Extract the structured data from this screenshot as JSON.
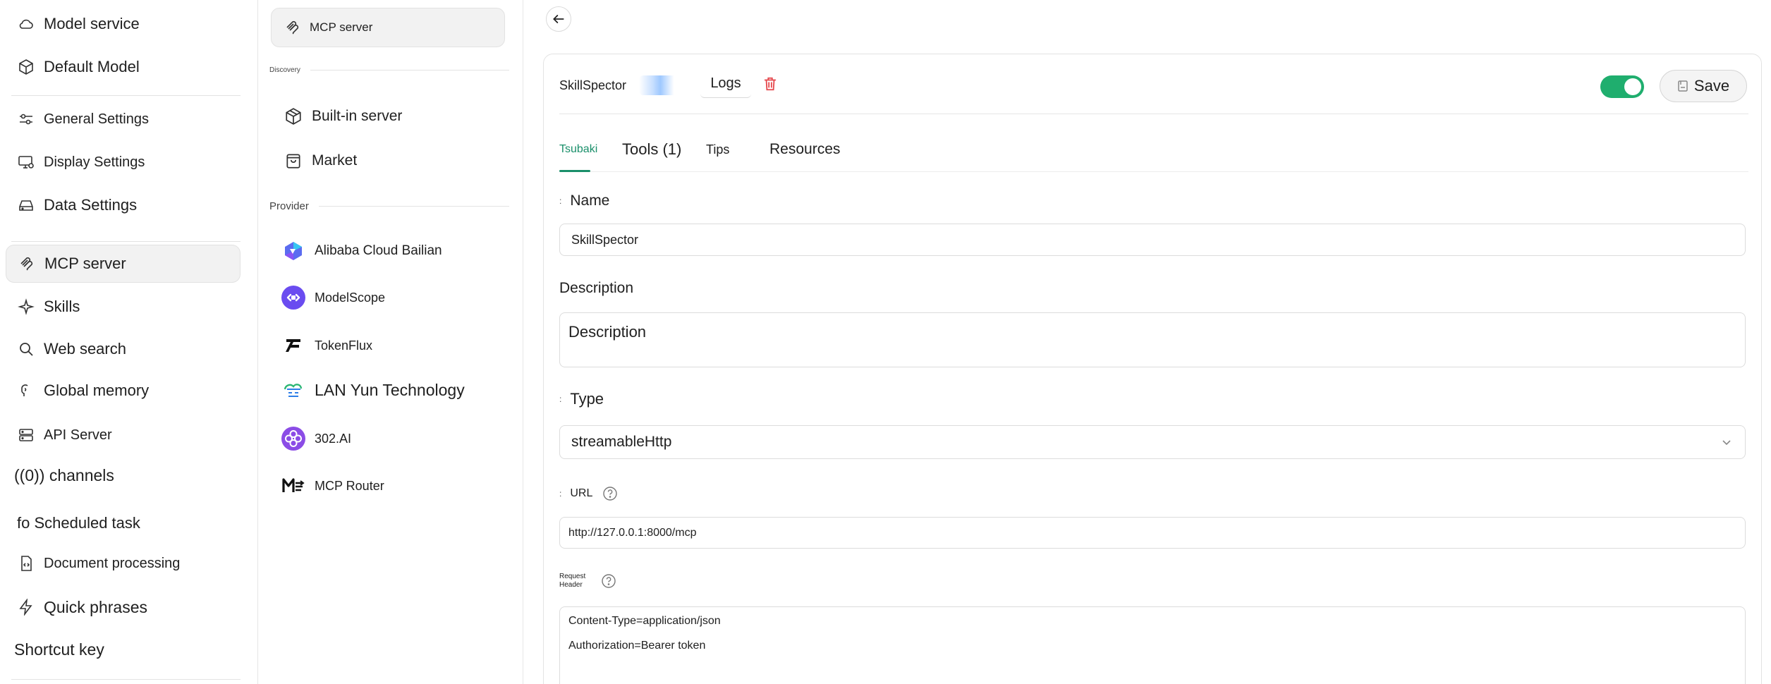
{
  "sidebar": {
    "items": [
      {
        "label": "Model service",
        "icon": "cloud-icon"
      },
      {
        "label": "Default Model",
        "icon": "cube-icon"
      },
      {
        "label": "General Settings",
        "icon": "sliders-icon"
      },
      {
        "label": "Display Settings",
        "icon": "monitor-settings-icon"
      },
      {
        "label": "Data Settings",
        "icon": "hard-drive-icon"
      },
      {
        "label": "MCP server",
        "icon": "mcp-icon"
      },
      {
        "label": "Skills",
        "icon": "sparkle-icon"
      },
      {
        "label": "Web search",
        "icon": "search-icon"
      },
      {
        "label": "Global memory",
        "icon": "brain-icon"
      },
      {
        "label": "API Server",
        "icon": "server-icon"
      },
      {
        "label": "((0)) channels",
        "icon": ""
      },
      {
        "label": "fo Scheduled task",
        "icon": ""
      },
      {
        "label": "Document processing",
        "icon": "file-code-icon"
      },
      {
        "label": "Quick phrases",
        "icon": "zap-icon"
      },
      {
        "label": "Shortcut key",
        "icon": ""
      }
    ]
  },
  "mcp_list": {
    "top_item": "MCP server",
    "discovery_label": "Discovery",
    "discovery_items": [
      {
        "label": "Built-in server",
        "icon": "package-icon"
      },
      {
        "label": "Market",
        "icon": "shopping-bag-icon"
      }
    ],
    "provider_label": "Provider",
    "providers": [
      {
        "label": "Alibaba Cloud Bailian",
        "icon": "bailian-logo-icon"
      },
      {
        "label": "ModelScope",
        "icon": "modelscope-logo-icon"
      },
      {
        "label": "TokenFlux",
        "icon": "tokenflux-logo-icon"
      },
      {
        "label": "LAN Yun Technology",
        "icon": "lanyun-logo-icon"
      },
      {
        "label": "302.AI",
        "icon": "302ai-logo-icon"
      },
      {
        "label": "MCP Router",
        "icon": "mcp-router-logo-icon"
      }
    ]
  },
  "server": {
    "name": "SkillSpector",
    "logs_label": "Logs",
    "save_label": "Save",
    "enabled": true,
    "accent_color": "#1fae6e"
  },
  "tabs": [
    {
      "label": "Tsubaki",
      "active": true
    },
    {
      "label": "Tools (1)",
      "active": false
    },
    {
      "label": "Tips",
      "active": false
    },
    {
      "label": "Resources",
      "active": false
    }
  ],
  "form": {
    "name_label": "Name",
    "name_required_mark": ":",
    "name_value": "SkillSpector",
    "description_label": "Description",
    "description_placeholder": "Description",
    "type_label": "Type",
    "type_required_mark": ":",
    "type_value": "streamableHttp",
    "url_label": "URL",
    "url_required_mark": ":",
    "url_value": "http://127.0.0.1:8000/mcp",
    "request_header_label_line1": "Request",
    "request_header_label_line2": "Header",
    "request_header_lines": [
      "Content-Type=application/json",
      "Authorization=Bearer token"
    ]
  }
}
